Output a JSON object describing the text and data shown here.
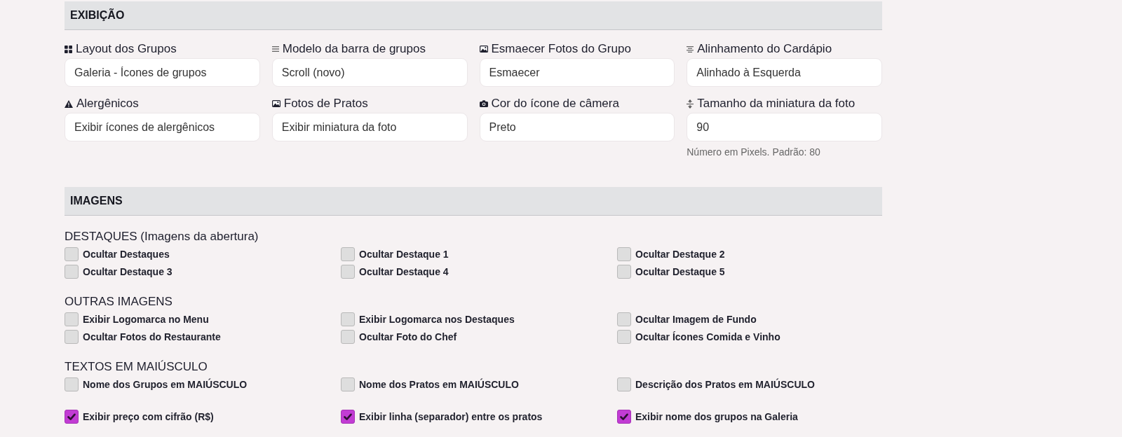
{
  "sections": [
    {
      "kind": "fields",
      "title": "EXIBIÇÃO",
      "fields": [
        {
          "label": "Layout dos Grupos",
          "value": "Galeria - Ícones de grupos"
        },
        {
          "label": "Modelo da barra de grupos",
          "value": "Scroll (novo)"
        },
        {
          "label": "Esmaecer Fotos do Grupo",
          "value": "Esmaecer"
        },
        {
          "label": "Alinhamento do Cardápio",
          "value": "Alinhado à Esquerda"
        },
        {
          "label": "Alergênicos",
          "value": "Exibir ícones de alergênicos"
        },
        {
          "label": "Fotos de Pratos",
          "value": "Exibir miniatura da foto"
        },
        {
          "label": "Cor do ícone de câmera",
          "value": "Preto"
        },
        {
          "label": "Tamanho da miniatura da foto",
          "value": "90",
          "help": "Número em Pixels. Padrão: 80"
        }
      ]
    },
    {
      "kind": "checkboxes",
      "title": "IMAGENS",
      "groups": [
        {
          "title": "DESTAQUES (Imagens da abertura)",
          "options": [
            {
              "label": "Ocultar Destaques",
              "checked": false
            },
            {
              "label": "Ocultar Destaque 1",
              "checked": false
            },
            {
              "label": "Ocultar Destaque 2",
              "checked": false
            },
            {
              "label": "Ocultar Destaque 3",
              "checked": false
            },
            {
              "label": "Ocultar Destaque 4",
              "checked": false
            },
            {
              "label": "Ocultar Destaque 5",
              "checked": false
            }
          ]
        },
        {
          "title": "OUTRAS IMAGENS",
          "options": [
            {
              "label": "Exibir Logomarca no Menu",
              "checked": false
            },
            {
              "label": "Exibir Logomarca nos Destaques",
              "checked": false
            },
            {
              "label": "Ocultar Imagem de Fundo",
              "checked": false
            },
            {
              "label": "Ocultar Fotos do Restaurante",
              "checked": false
            },
            {
              "label": "Ocultar Foto do Chef",
              "checked": false
            },
            {
              "label": "Ocultar Ícones Comida e Vinho",
              "checked": false
            }
          ]
        },
        {
          "title": "TEXTOS EM MAIÚSCULO",
          "options": [
            {
              "label": "Nome dos Grupos em MAIÚSCULO",
              "checked": false
            },
            {
              "label": "Nome dos Pratos em MAIÚSCULO",
              "checked": false
            },
            {
              "label": "Descrição dos Pratos em MAIÚSCULO",
              "checked": false
            }
          ]
        },
        {
          "options": [
            {
              "label": "Exibir preço com cifrão (R$)",
              "checked": true
            },
            {
              "label": "Exibir linha (separador) entre os pratos",
              "checked": true
            },
            {
              "label": "Exibir nome dos grupos na Galeria",
              "checked": true
            }
          ]
        }
      ]
    }
  ]
}
